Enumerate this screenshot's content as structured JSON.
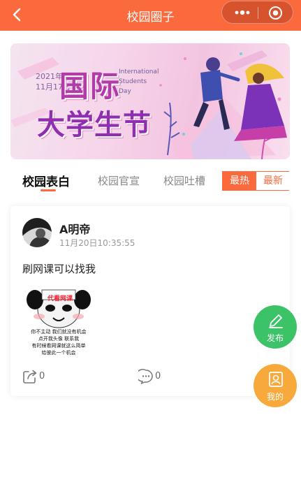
{
  "nav": {
    "title": "校园圈子"
  },
  "banner": {
    "date_line1": "2021年",
    "date_line2": "11月17日",
    "title_line1": "国际",
    "title_line2": "大学生节",
    "english": "International Students Day"
  },
  "tabs": [
    {
      "label": "校园表白",
      "active": true
    },
    {
      "label": "校园官宣",
      "active": false
    },
    {
      "label": "校园吐槽",
      "active": false
    }
  ],
  "sort": {
    "hot": "最热",
    "new": "最新",
    "selected": "最热"
  },
  "post": {
    "username": "A明帝",
    "time": "11月20日10:35:55",
    "text": "刷网课可以找我",
    "image": {
      "sign_text": "代看网课",
      "line1": "你不主动  我们就没有机会",
      "line2": "点开我头像    联系我",
      "line3": "有时候看网课就这么简单",
      "line4": "给彼此一个机会"
    },
    "share_count": "0",
    "comment_count": "0"
  },
  "fab": {
    "publish": "发布",
    "mine": "我的"
  },
  "colors": {
    "accent": "#fb6a3c",
    "publish": "#3cc367",
    "mine": "#f8a93c"
  }
}
